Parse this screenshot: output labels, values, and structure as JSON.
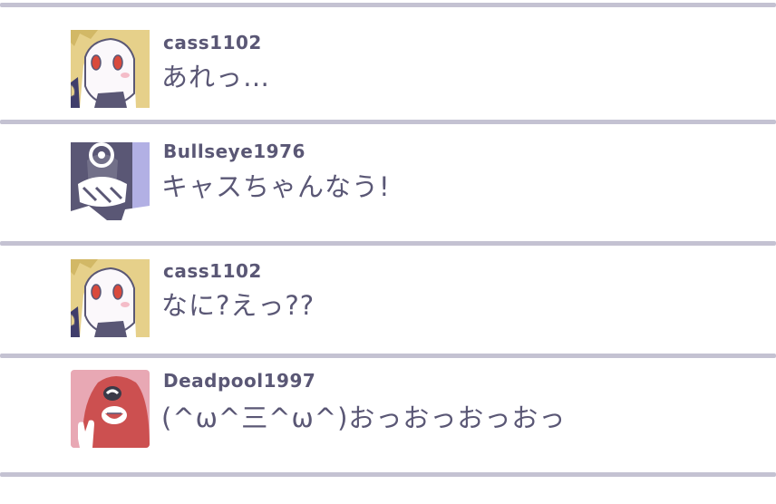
{
  "posts": [
    {
      "username": "cass1102",
      "message": "あれっ…",
      "avatar_icon": "blonde-girl-avatar-icon"
    },
    {
      "username": "Bullseye1976",
      "message": "キャスちゃんなう!",
      "avatar_icon": "masked-man-avatar-icon"
    },
    {
      "username": "cass1102",
      "message": "なに?えっ??",
      "avatar_icon": "blonde-girl-avatar-icon"
    },
    {
      "username": "Deadpool1997",
      "message": "(^ω^三^ω^)おっおっおっおっ",
      "avatar_icon": "red-mask-avatar-icon"
    }
  ],
  "colors": {
    "text": "#5a5775",
    "divider": "#c4c2d2",
    "background": "#ffffff"
  }
}
